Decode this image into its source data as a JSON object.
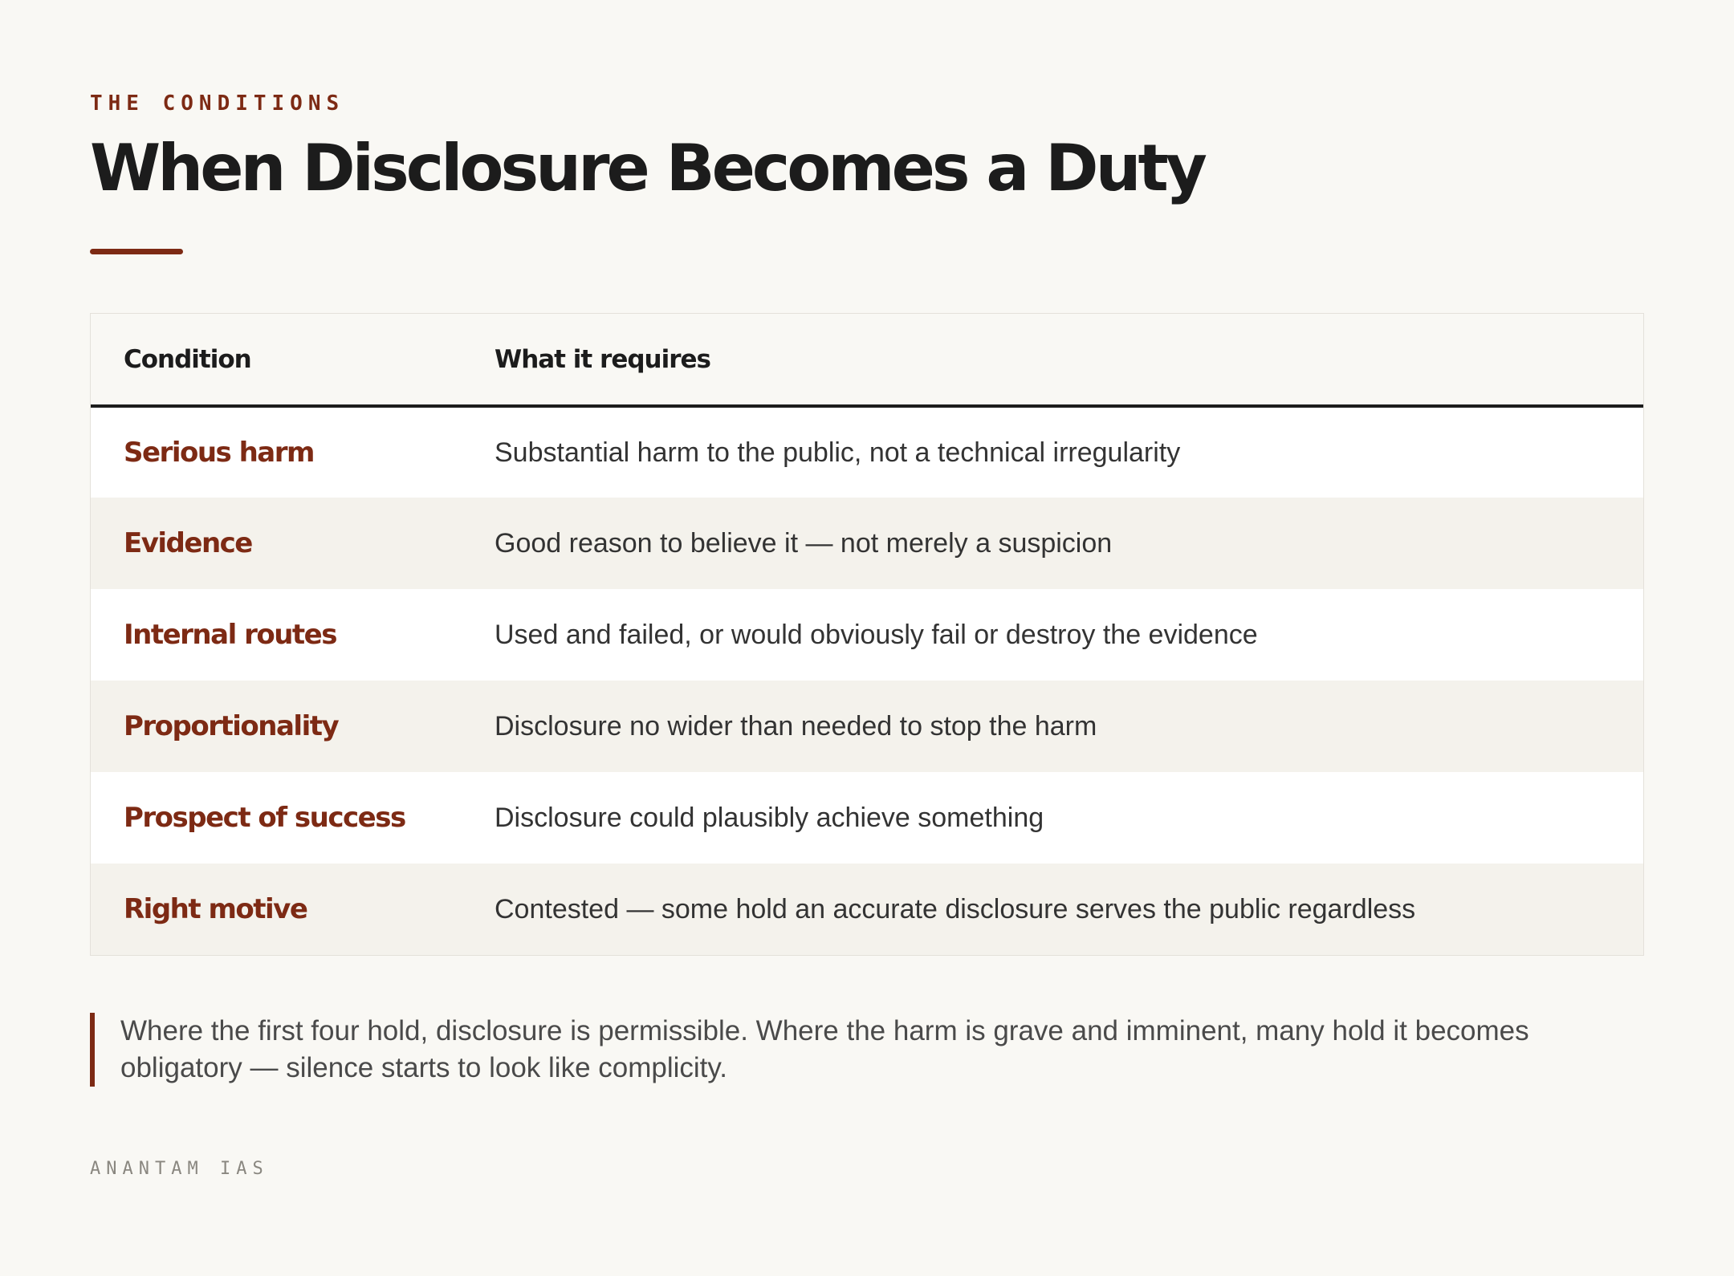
{
  "header": {
    "eyebrow": "THE CONDITIONS",
    "title": "When Disclosure Becomes a Duty"
  },
  "table": {
    "columns": [
      "Condition",
      "What it requires"
    ],
    "rows": [
      {
        "condition": "Serious harm",
        "requirement": "Substantial harm to the public, not a technical irregularity"
      },
      {
        "condition": "Evidence",
        "requirement": "Good reason to believe it — not merely a suspicion"
      },
      {
        "condition": "Internal routes",
        "requirement": "Used and failed, or would obviously fail or destroy the evidence"
      },
      {
        "condition": "Proportionality",
        "requirement": "Disclosure no wider than needed to stop the harm"
      },
      {
        "condition": "Prospect of success",
        "requirement": "Disclosure could plausibly achieve something"
      },
      {
        "condition": "Right motive",
        "requirement": "Contested — some hold an accurate disclosure serves the public regardless"
      }
    ]
  },
  "note": {
    "text": "Where the first four hold, disclosure is permissible. Where the harm is grave and imminent, many hold it becomes obligatory — silence starts to look like complicity."
  },
  "footer": {
    "brand": "ANANTAM IAS"
  },
  "colors": {
    "accent": "#7d2a14",
    "background": "#f9f8f4",
    "text": "#1c1c1c",
    "row_alt": "#f4f2ec"
  }
}
